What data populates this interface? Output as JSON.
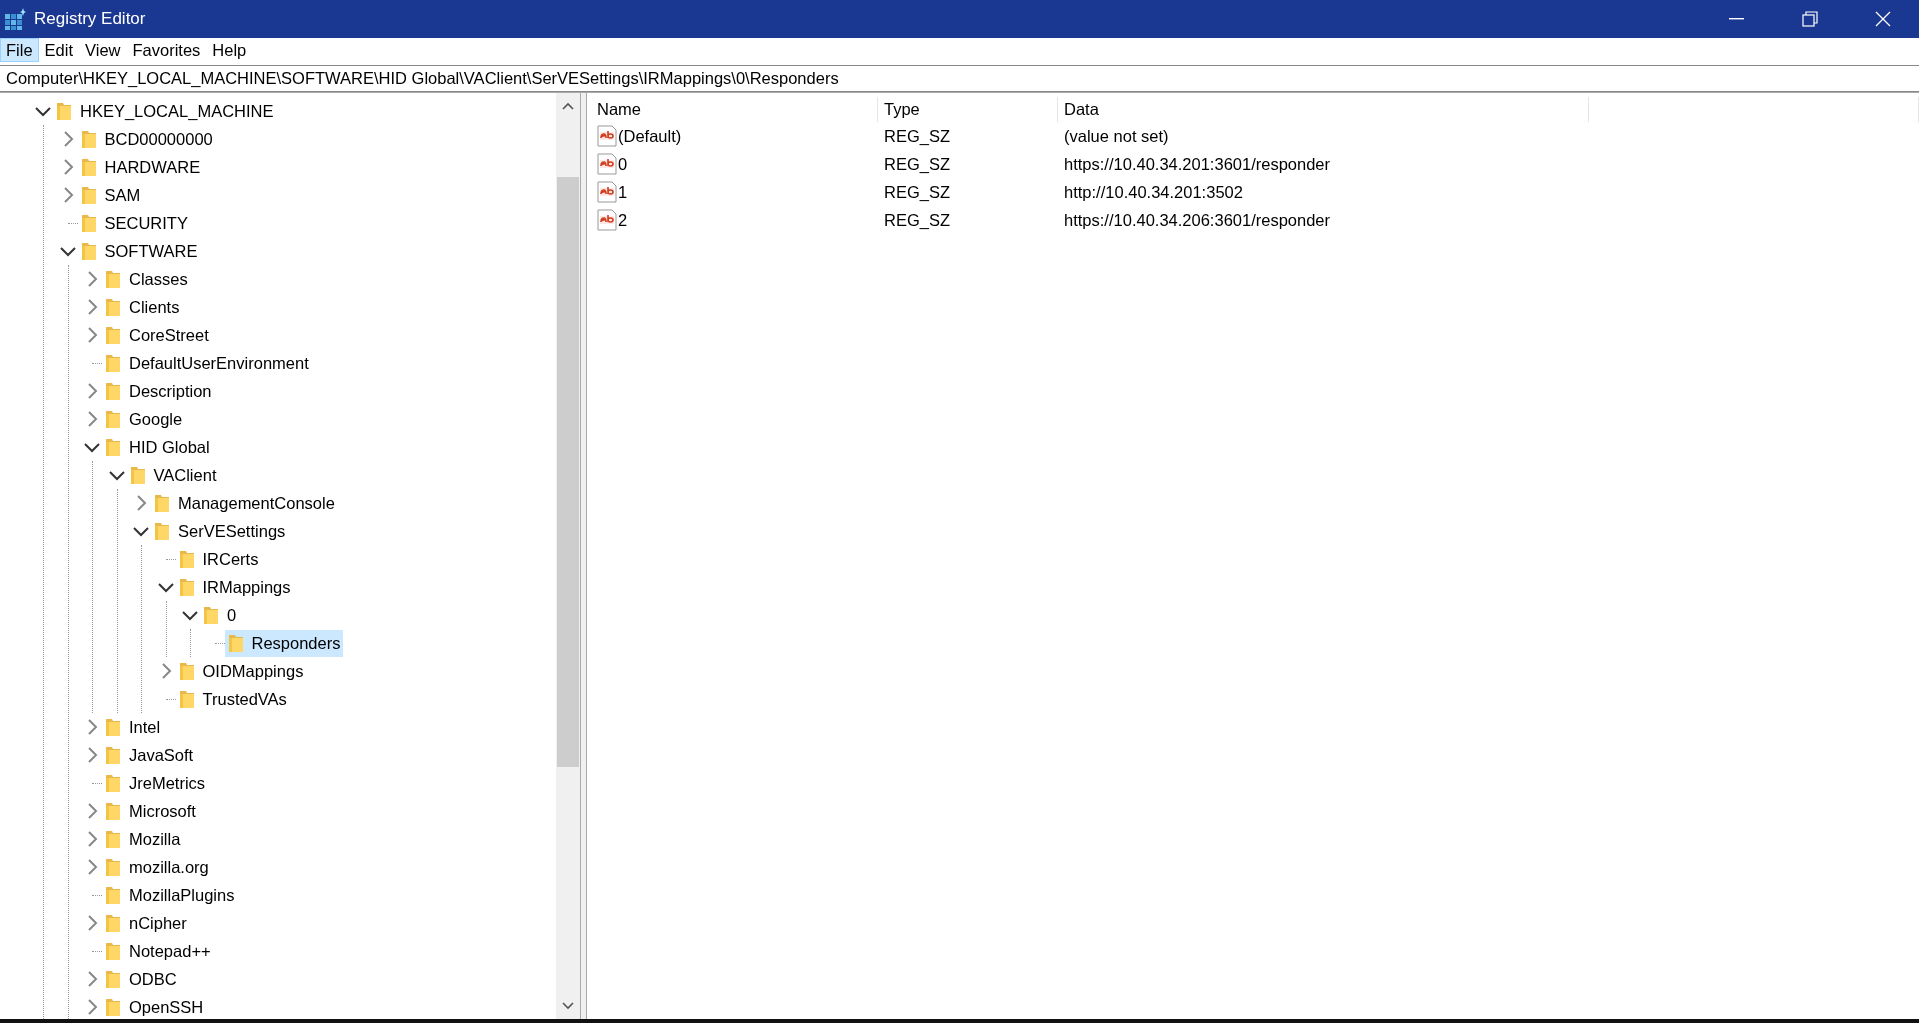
{
  "window": {
    "title": "Registry Editor"
  },
  "menu": [
    {
      "label": "File",
      "selected": true
    },
    {
      "label": "Edit",
      "selected": false
    },
    {
      "label": "View",
      "selected": false
    },
    {
      "label": "Favorites",
      "selected": false
    },
    {
      "label": "Help",
      "selected": false
    }
  ],
  "address_bar": {
    "value": "Computer\\HKEY_LOCAL_MACHINE\\SOFTWARE\\HID Global\\VAClient\\SerVESettings\\IRMappings\\0\\Responders"
  },
  "tree": [
    {
      "label": "HKEY_LOCAL_MACHINE",
      "kind": "branch",
      "expanded": true,
      "selected": false,
      "children": [
        {
          "label": "BCD00000000",
          "kind": "branch",
          "expanded": false,
          "selected": false
        },
        {
          "label": "HARDWARE",
          "kind": "branch",
          "expanded": false,
          "selected": false
        },
        {
          "label": "SAM",
          "kind": "branch",
          "expanded": false,
          "selected": false
        },
        {
          "label": "SECURITY",
          "kind": "leaf",
          "selected": false
        },
        {
          "label": "SOFTWARE",
          "kind": "branch",
          "expanded": true,
          "selected": false,
          "children": [
            {
              "label": "Classes",
              "kind": "branch",
              "expanded": false,
              "selected": false
            },
            {
              "label": "Clients",
              "kind": "branch",
              "expanded": false,
              "selected": false
            },
            {
              "label": "CoreStreet",
              "kind": "branch",
              "expanded": false,
              "selected": false
            },
            {
              "label": "DefaultUserEnvironment",
              "kind": "leaf",
              "selected": false
            },
            {
              "label": "Description",
              "kind": "branch",
              "expanded": false,
              "selected": false
            },
            {
              "label": "Google",
              "kind": "branch",
              "expanded": false,
              "selected": false
            },
            {
              "label": "HID Global",
              "kind": "branch",
              "expanded": true,
              "selected": false,
              "children": [
                {
                  "label": "VAClient",
                  "kind": "branch",
                  "expanded": true,
                  "selected": false,
                  "children": [
                    {
                      "label": "ManagementConsole",
                      "kind": "branch",
                      "expanded": false,
                      "selected": false
                    },
                    {
                      "label": "SerVESettings",
                      "kind": "branch",
                      "expanded": true,
                      "selected": false,
                      "children": [
                        {
                          "label": "IRCerts",
                          "kind": "leaf",
                          "selected": false
                        },
                        {
                          "label": "IRMappings",
                          "kind": "branch",
                          "expanded": true,
                          "selected": false,
                          "children": [
                            {
                              "label": "0",
                              "kind": "branch",
                              "expanded": true,
                              "selected": false,
                              "children": [
                                {
                                  "label": "Responders",
                                  "kind": "leaf",
                                  "selected": true
                                }
                              ]
                            }
                          ]
                        },
                        {
                          "label": "OIDMappings",
                          "kind": "branch",
                          "expanded": false,
                          "selected": false
                        },
                        {
                          "label": "TrustedVAs",
                          "kind": "leaf",
                          "selected": false
                        }
                      ]
                    }
                  ]
                }
              ]
            },
            {
              "label": "Intel",
              "kind": "branch",
              "expanded": false,
              "selected": false
            },
            {
              "label": "JavaSoft",
              "kind": "branch",
              "expanded": false,
              "selected": false
            },
            {
              "label": "JreMetrics",
              "kind": "leaf",
              "selected": false
            },
            {
              "label": "Microsoft",
              "kind": "branch",
              "expanded": false,
              "selected": false
            },
            {
              "label": "Mozilla",
              "kind": "branch",
              "expanded": false,
              "selected": false
            },
            {
              "label": "mozilla.org",
              "kind": "branch",
              "expanded": false,
              "selected": false
            },
            {
              "label": "MozillaPlugins",
              "kind": "leaf",
              "selected": false
            },
            {
              "label": "nCipher",
              "kind": "branch",
              "expanded": false,
              "selected": false
            },
            {
              "label": "Notepad++",
              "kind": "leaf",
              "selected": false
            },
            {
              "label": "ODBC",
              "kind": "branch",
              "expanded": false,
              "selected": false
            },
            {
              "label": "OpenSSH",
              "kind": "branch",
              "expanded": false,
              "selected": false
            }
          ]
        }
      ]
    }
  ],
  "values": {
    "columns": [
      "Name",
      "Type",
      "Data"
    ],
    "rows": [
      {
        "name": "(Default)",
        "type": "REG_SZ",
        "data": "(value not set)"
      },
      {
        "name": "0",
        "type": "REG_SZ",
        "data": "https://10.40.34.201:3601/responder"
      },
      {
        "name": "1",
        "type": "REG_SZ",
        "data": "http://10.40.34.201:3502"
      },
      {
        "name": "2",
        "type": "REG_SZ",
        "data": "https://10.40.34.206:3601/responder"
      }
    ]
  }
}
